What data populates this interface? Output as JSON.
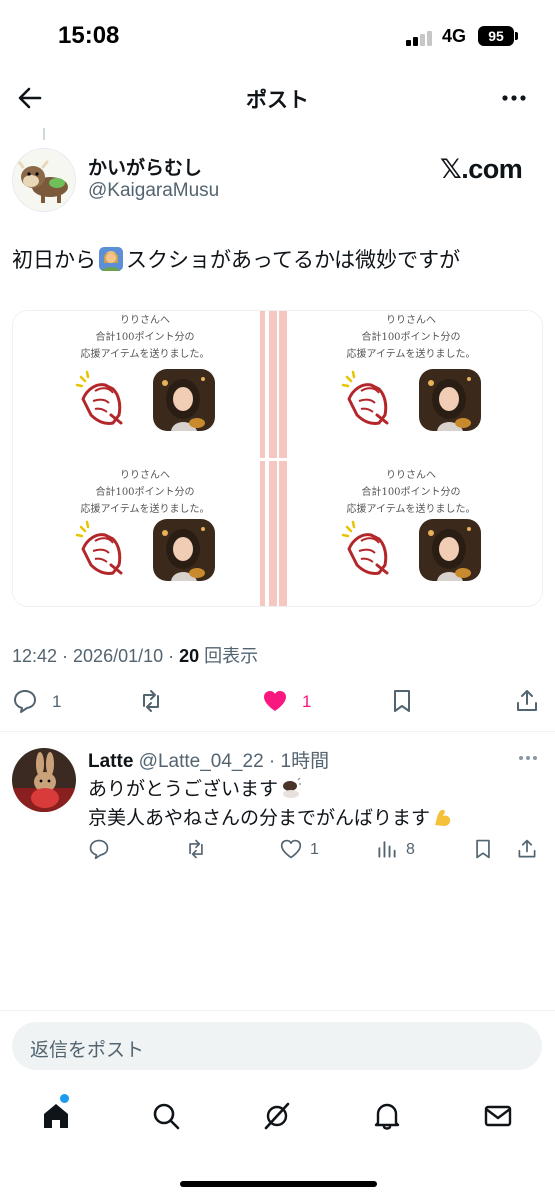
{
  "status_bar": {
    "time": "15:08",
    "network": "4G",
    "battery": "95"
  },
  "header": {
    "title": "ポスト"
  },
  "post": {
    "author_name": "かいがらむし",
    "author_handle": "@KaigaraMusu",
    "source_badge": "𝕏.com",
    "text_before_emoji": "初日から",
    "text_after_emoji": "スクショがあってるかは微妙ですが",
    "timestamp": "12:42 · 2026/01/10 · ",
    "views_count": "20",
    "views_label": " 回表示",
    "media_cards": [
      {
        "line1": "りりさんへ",
        "line2": "合計100ポイント分の",
        "line3": "応援アイテムを送りました。"
      },
      {
        "line1": "りりさんへ",
        "line2": "合計100ポイント分の",
        "line3": "応援アイテムを送りました。"
      },
      {
        "line1": "りりさんへ",
        "line2": "合計100ポイント分の",
        "line3": "応援アイテムを送りました。"
      },
      {
        "line1": "りりさんへ",
        "line2": "合計100ポイント分の",
        "line3": "応援アイテムを送りました。"
      }
    ],
    "actions": {
      "replies": "1",
      "likes": "1",
      "liked_color": "#f91880"
    }
  },
  "reply": {
    "name": "Latte",
    "handle_time": " @Latte_04_22 · 1時間",
    "line1": "ありがとうございます",
    "line2": "京美人あやねさんの分までがんばります",
    "actions": {
      "likes": "1",
      "views": "8"
    }
  },
  "composer": {
    "placeholder": "返信をポスト"
  },
  "tabs": [
    "home-icon",
    "search-icon",
    "grok-icon",
    "notifications-icon",
    "messages-icon"
  ],
  "colors": {
    "accent": "#1d9bf0",
    "like": "#f91880",
    "secondary_text": "#536471",
    "card_stripe": "#f6c6c1"
  }
}
